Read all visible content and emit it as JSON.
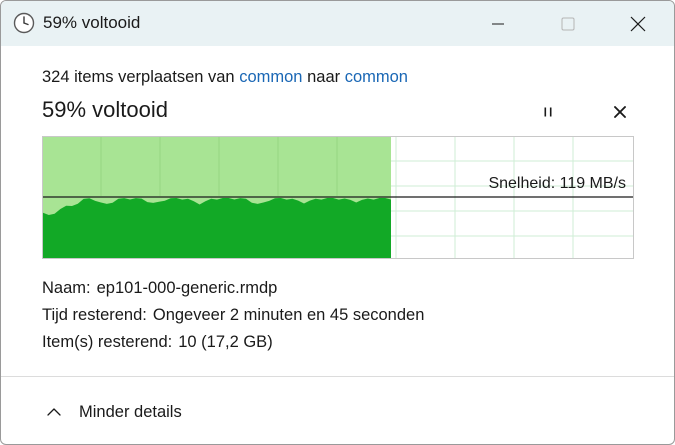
{
  "window": {
    "title": "59% voltooid"
  },
  "operation": {
    "count_prefix": "324 items verplaatsen van",
    "source": "common",
    "mid_word": "naar",
    "destination": "common"
  },
  "progress": {
    "label": "59% voltooid",
    "fraction": 0.59
  },
  "speed": {
    "text": "Snelheid: 119 MB/s"
  },
  "details": {
    "name_label": "Naam:",
    "name_value": "ep101-000-generic.rmdp",
    "time_label": "Tijd resterend:",
    "time_value": "Ongeveer 2 minuten en 45 seconden",
    "items_label": "Item(s) resterend:",
    "items_value": "10 (17,2 GB)"
  },
  "footer": {
    "toggle_label": "Minder details"
  },
  "icons": {
    "title": "clock-icon",
    "minimize": "minimize-icon",
    "maximize": "maximize-icon",
    "close": "close-icon",
    "pause": "pause-icon",
    "stop": "stop-icon",
    "toggle": "chevron-up-icon"
  },
  "colors": {
    "titlebar": "#e9f2f4",
    "link": "#1a67b5",
    "progress_light": "#a8e494",
    "speed_fill": "#12a926",
    "grid": "#c8ecd0"
  }
}
